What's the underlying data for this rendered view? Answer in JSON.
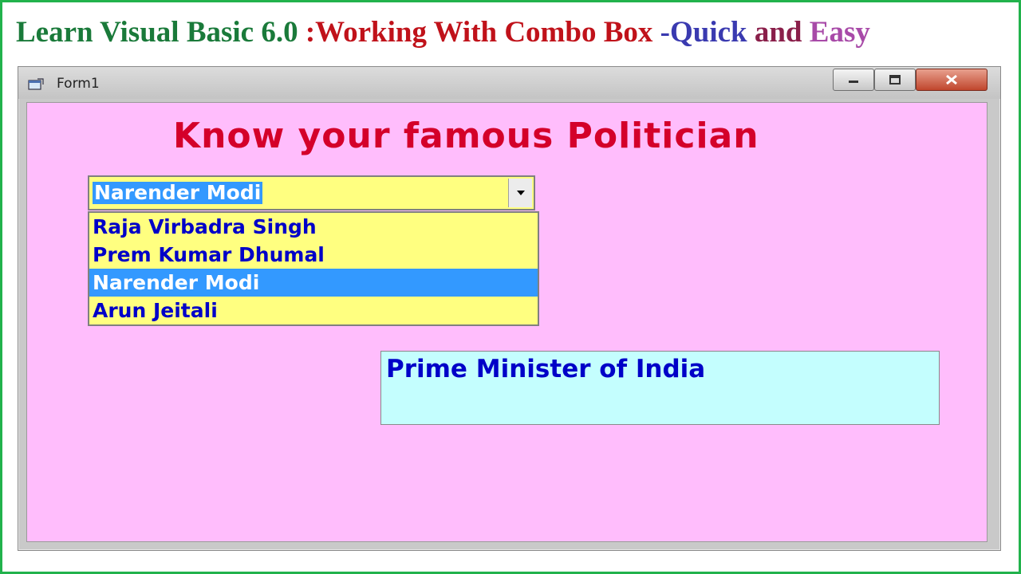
{
  "headline": {
    "part1": "Learn Visual Basic 6.0 ",
    "part2": ":Working With Combo Box ",
    "part3": "-",
    "part4": "Quick ",
    "part5": "and ",
    "part6": "Easy",
    "colors": {
      "part1": "#1a7a3a",
      "part2": "#c0121a",
      "part3": "#3a3ab0",
      "part4": "#3a3ab0",
      "part5": "#8a1f4a",
      "part6": "#a84aa8"
    }
  },
  "window": {
    "title": "Form1",
    "icon": "form-icon",
    "controls": [
      "minimize-icon",
      "maximize-icon",
      "close-icon"
    ]
  },
  "form": {
    "heading": "Know your famous Politician",
    "combo": {
      "selected": "Narender Modi",
      "options": [
        "Raja Virbadra Singh",
        "Prem Kumar Dhumal",
        "Narender Modi",
        "Arun Jeitali"
      ],
      "selected_index": 2
    },
    "info_text": "Prime Minister of India"
  },
  "colors": {
    "frame_border": "#22b24c",
    "form_background": "#ffbdfc",
    "combo_background": "#ffff80",
    "selection": "#3399ff",
    "list_text": "#0000c8",
    "heading_text": "#d4002a",
    "info_background": "#c4fefe"
  }
}
